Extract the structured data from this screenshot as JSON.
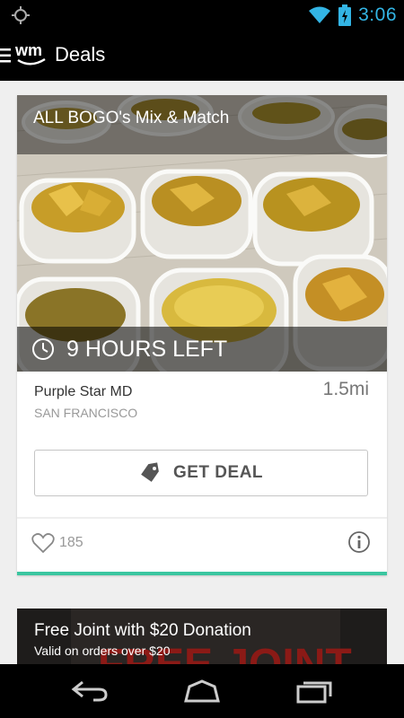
{
  "status_bar": {
    "time": "3:06",
    "icons": [
      "gps-icon",
      "wifi-icon",
      "battery-icon"
    ]
  },
  "app_bar": {
    "logo_text": "wm",
    "title": "Deals",
    "icons": [
      "menu-icon"
    ]
  },
  "deals": [
    {
      "title": "ALL BOGO's Mix & Match",
      "time_left": "9 HOURS LEFT",
      "store_name": "Purple Star MD",
      "city": "SAN FRANCISCO",
      "distance": "1.5mi",
      "button_label": "GET DEAL",
      "likes": "185",
      "icons": [
        "clock-icon",
        "tag-icon",
        "heart-icon",
        "info-icon"
      ]
    },
    {
      "title": "Free Joint with $20 Donation",
      "subtitle": "Valid on orders over $20",
      "image_text": "FREE JOINT"
    }
  ],
  "colors": {
    "accent": "#3bc6a0",
    "status_blue": "#33b5e5",
    "bar_black": "#000000"
  },
  "nav_bar": {
    "icons": [
      "back-icon",
      "home-icon",
      "recents-icon"
    ]
  }
}
